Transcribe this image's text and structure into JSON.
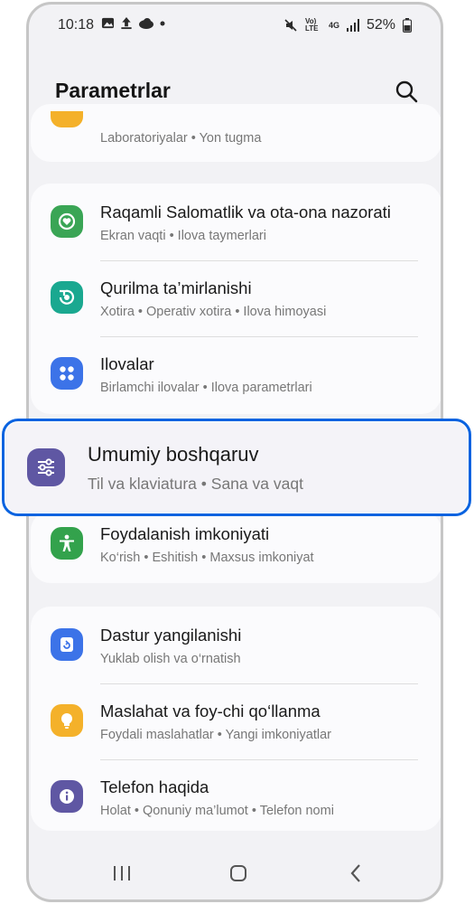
{
  "status": {
    "time": "10:18",
    "battery": "52%",
    "network": "4G",
    "volte": "Vo) LTE"
  },
  "header": {
    "title": "Parametrlar"
  },
  "groups": {
    "top_partial": {
      "subtitle": "Laboratoriyalar  •  Yon tugma"
    },
    "main1": [
      {
        "title": "Raqamli Salomatlik va ota-ona nazorati",
        "subtitle": "Ekran vaqti  •  Ilova taymerlari",
        "icon": "digital-wellbeing-icon",
        "color": "#3aa555"
      },
      {
        "title": "Qurilma ta’mirlanishi",
        "subtitle": "Xotira  •  Operativ xotira  •  Ilova himoyasi",
        "icon": "device-care-icon",
        "color": "#1aa890"
      },
      {
        "title": "Ilovalar",
        "subtitle": "Birlamchi ilovalar  •  Ilova parametrlari",
        "icon": "apps-icon",
        "color": "#3c73e8"
      }
    ],
    "highlight": {
      "title": "Umumiy boshqaruv",
      "subtitle": "Til va klaviatura  •  Sana va vaqt",
      "icon": "general-management-icon",
      "color": "#5f57a3"
    },
    "accessibility": {
      "title": "Foydalanish imkoniyati",
      "subtitle": "Ko‘rish  •  Eshitish  •  Maxsus imkoniyat",
      "icon": "accessibility-icon",
      "color": "#33a24c"
    },
    "main2": [
      {
        "title": "Dastur yangilanishi",
        "subtitle": "Yuklab olish va o‘rnatish",
        "icon": "software-update-icon",
        "color": "#3c73e8"
      },
      {
        "title": "Maslahat va foy-chi qo‘llanma",
        "subtitle": "Foydali maslahatlar  •  Yangi imkoniyatlar",
        "icon": "tips-icon",
        "color": "#f4b12a"
      },
      {
        "title": "Telefon haqida",
        "subtitle": "Holat  •  Qonuniy ma’lumot  •  Telefon nomi",
        "icon": "about-phone-icon",
        "color": "#5f57a3"
      }
    ]
  },
  "colors": {
    "accent": "#0a63e0",
    "background": "#f2f2f5",
    "card": "#fbfbfd"
  }
}
